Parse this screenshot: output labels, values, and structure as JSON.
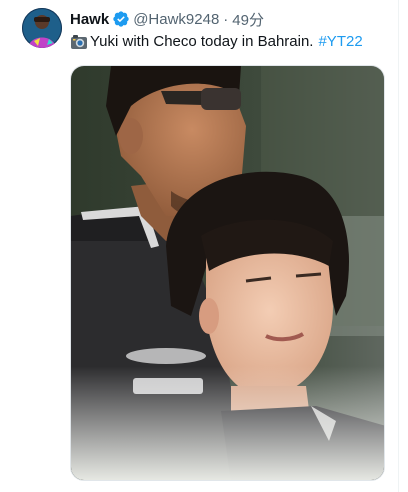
{
  "tweet": {
    "name": "Hawk",
    "handle": "@Hawk9248",
    "separator": "·",
    "time": "49分",
    "text_icon": "camera-icon",
    "text": "Yuki with Checo today in Bahrain.",
    "hashtag": "#YT22"
  },
  "colors": {
    "accent": "#1d9bf0",
    "text": "#0f1419",
    "secondary": "#536471"
  }
}
